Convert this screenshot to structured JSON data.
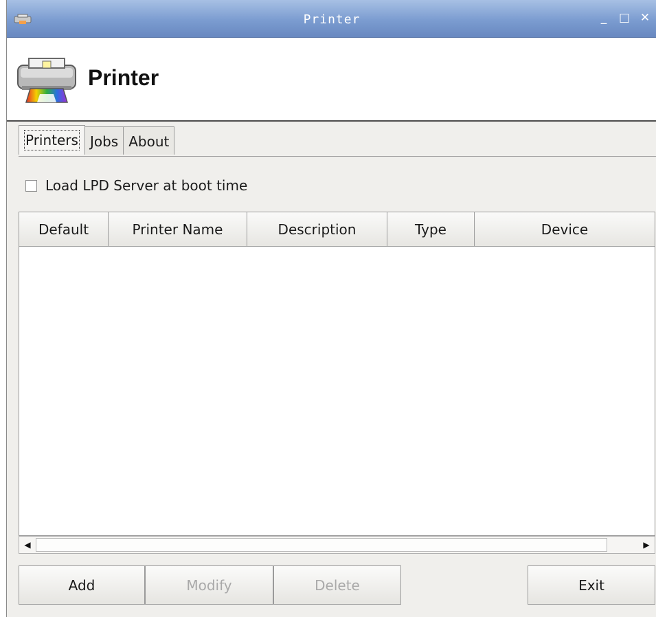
{
  "window": {
    "title": "Printer",
    "controls": {
      "minimize": "_",
      "maximize": "□",
      "close": "✕"
    }
  },
  "header": {
    "title": "Printer",
    "icon": "printer-icon"
  },
  "tabs": [
    {
      "label": "Printers",
      "active": true
    },
    {
      "label": "Jobs",
      "active": false
    },
    {
      "label": "About",
      "active": false
    }
  ],
  "options": {
    "load_lpd_label": "Load LPD Server at boot time",
    "load_lpd_checked": false
  },
  "table": {
    "columns": [
      "Default",
      "Printer Name",
      "Description",
      "Type",
      "Device"
    ],
    "rows": []
  },
  "scrollbar": {
    "left_arrow": "◀",
    "right_arrow": "▶"
  },
  "buttons": {
    "add": "Add",
    "modify": "Modify",
    "delete": "Delete",
    "exit": "Exit"
  }
}
